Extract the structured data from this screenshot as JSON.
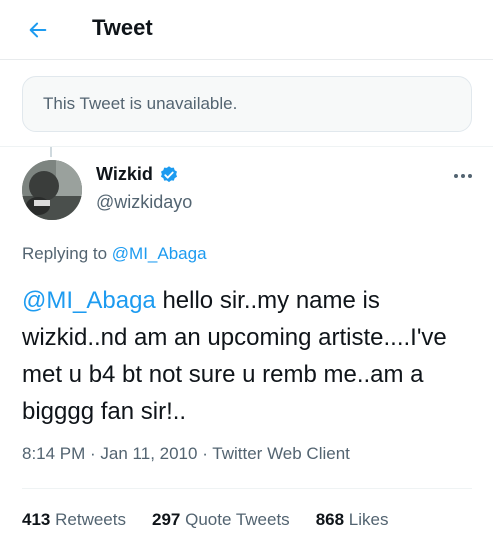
{
  "header": {
    "title": "Tweet",
    "back_icon": "arrow-left-icon"
  },
  "notice": {
    "text": "This Tweet is unavailable."
  },
  "tweet": {
    "author": {
      "display_name": "Wizkid",
      "handle": "@wizkidayo",
      "verified": true,
      "verified_color": "#1d9bf0"
    },
    "replying_prefix": "Replying to ",
    "replying_to": "@MI_Abaga",
    "body_mention": "@MI_Abaga",
    "body_text": " hello sir..my name is wizkid..nd am an upcoming artiste....I've met u b4 bt not sure u remb me..am a bigggg fan sir!..",
    "time": "8:14 PM",
    "date": "Jan 11, 2010",
    "source": "Twitter Web Client",
    "sep": " · "
  },
  "stats": {
    "retweets": {
      "count": "413",
      "label": "Retweets"
    },
    "quotes": {
      "count": "297",
      "label": "Quote Tweets"
    },
    "likes": {
      "count": "868",
      "label": "Likes"
    }
  },
  "colors": {
    "accent": "#1d9bf0",
    "secondary_text": "#536471"
  }
}
